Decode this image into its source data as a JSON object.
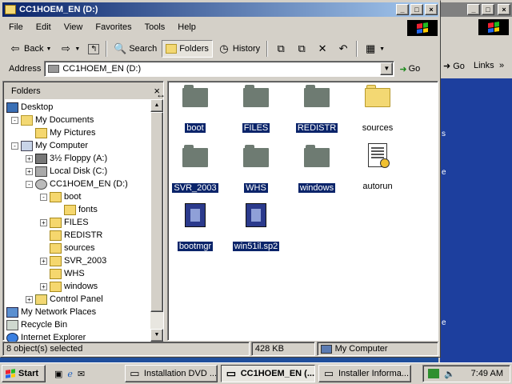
{
  "window": {
    "title": "CC1HOEM_EN (D:)",
    "minimize": "_",
    "maximize": "□",
    "close": "×"
  },
  "menubar": [
    "File",
    "Edit",
    "View",
    "Favorites",
    "Tools",
    "Help"
  ],
  "toolbar": {
    "back": "Back",
    "search": "Search",
    "folders": "Folders",
    "history": "History"
  },
  "address": {
    "label": "Address",
    "value": "CC1HOEM_EN (D:)",
    "go": "Go"
  },
  "folders_pane": {
    "title": "Folders",
    "close": "×",
    "tree": [
      {
        "label": "Desktop",
        "icon": "desktop-icon"
      },
      {
        "label": "My Documents",
        "icon": "my-documents-icon"
      },
      {
        "label": "My Pictures",
        "icon": "folder-icon"
      },
      {
        "label": "My Computer",
        "icon": "my-computer-icon"
      },
      {
        "label": "3½ Floppy (A:)",
        "icon": "floppy-icon"
      },
      {
        "label": "Local Disk (C:)",
        "icon": "disk-icon"
      },
      {
        "label": "CC1HOEM_EN (D:)",
        "icon": "cd-drive-icon"
      },
      {
        "label": "boot",
        "icon": "folder-icon"
      },
      {
        "label": "fonts",
        "icon": "folder-icon"
      },
      {
        "label": "FILES",
        "icon": "folder-icon"
      },
      {
        "label": "REDISTR",
        "icon": "folder-icon"
      },
      {
        "label": "sources",
        "icon": "folder-icon"
      },
      {
        "label": "SVR_2003",
        "icon": "folder-icon"
      },
      {
        "label": "WHS",
        "icon": "folder-icon"
      },
      {
        "label": "windows",
        "icon": "folder-icon"
      },
      {
        "label": "Control Panel",
        "icon": "control-panel-icon"
      },
      {
        "label": "My Network Places",
        "icon": "network-icon"
      },
      {
        "label": "Recycle Bin",
        "icon": "recycle-bin-icon"
      },
      {
        "label": "Internet Explorer",
        "icon": "ie-icon"
      }
    ]
  },
  "items": [
    {
      "label": "boot",
      "kind": "folder-grey",
      "selected": true
    },
    {
      "label": "FILES",
      "kind": "folder-grey",
      "selected": true
    },
    {
      "label": "REDISTR",
      "kind": "folder-grey",
      "selected": true
    },
    {
      "label": "sources",
      "kind": "folder-yellow",
      "selected": false
    },
    {
      "label": "SVR_2003",
      "kind": "folder-grey",
      "selected": true
    },
    {
      "label": "WHS",
      "kind": "folder-grey",
      "selected": true
    },
    {
      "label": "windows",
      "kind": "folder-grey",
      "selected": true
    },
    {
      "label": "autorun",
      "kind": "setup-info-icon",
      "selected": false
    },
    {
      "label": "bootmgr",
      "kind": "system-file-icon",
      "selected": true
    },
    {
      "label": "win51il.sp2",
      "kind": "system-file-icon",
      "selected": true
    }
  ],
  "status": {
    "objects": "8 object(s) selected",
    "size": "428 KB",
    "location": "My Computer"
  },
  "bg_window": {
    "go": "Go",
    "links": "Links"
  },
  "taskbar": {
    "start": "Start",
    "tasks": [
      "Installation DVD ...",
      "CC1HOEM_EN (...",
      "Installer Informa..."
    ],
    "clock": "7:49 AM"
  }
}
